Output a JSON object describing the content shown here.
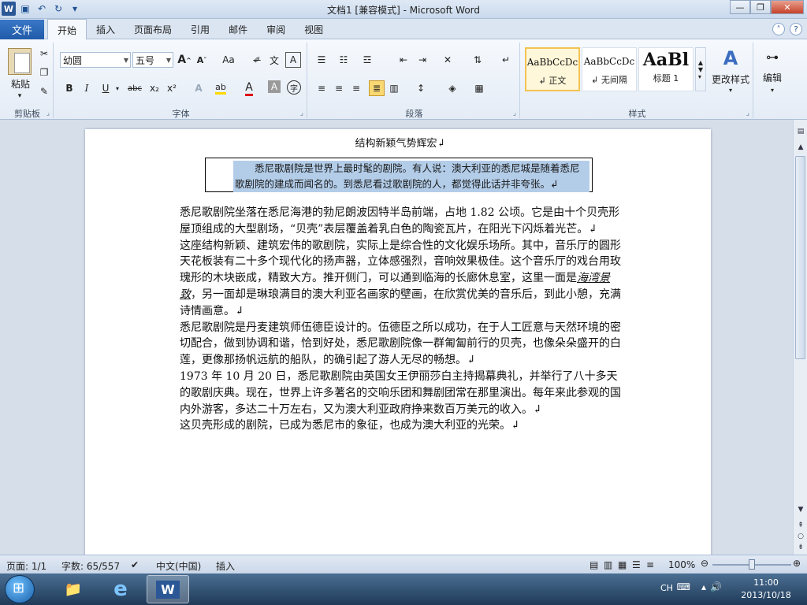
{
  "window": {
    "title": "文档1 [兼容模式] - Microsoft Word",
    "app_icon": "W"
  },
  "tabs": {
    "file": "文件",
    "items": [
      "开始",
      "插入",
      "页面布局",
      "引用",
      "邮件",
      "审阅",
      "视图"
    ],
    "active": "开始"
  },
  "ribbon": {
    "clipboard": {
      "label": "剪贴板",
      "paste": "粘贴"
    },
    "font": {
      "label": "字体",
      "font_name": "幼圆",
      "font_size": "五号",
      "grow": "A",
      "shrink": "A",
      "change_case": "Aa",
      "bold": "B",
      "italic": "I",
      "underline": "U",
      "strike": "abc",
      "subscript": "x₂",
      "superscript": "x²",
      "text_effect": "A",
      "highlight": "ab",
      "font_color": "A",
      "char_shading": "A",
      "enclose": "字"
    },
    "paragraph": {
      "label": "段落"
    },
    "styles": {
      "label": "样式",
      "items": [
        {
          "sample": "AaBbCcDc",
          "name": "↲ 正文"
        },
        {
          "sample": "AaBbCcDc",
          "name": "↲ 无间隔"
        },
        {
          "sample": "AaBl",
          "name": "标题 1"
        }
      ],
      "change_styles": "更改样式"
    },
    "editing": {
      "label": "编辑"
    }
  },
  "document": {
    "title": "结构新颖气势辉宏↲",
    "quote": "悉尼歌剧院是世界上最时髦的剧院。有人说：澳大利亚的悉尼城是随着悉尼歌剧院的建成而闻名的。到悉尼看过歌剧院的人，都觉得此话并非夸张。↲",
    "paragraphs": [
      "悉尼歌剧院坐落在悉尼海港的勃尼朗波因特半岛前端，占地 1.82 公顷。它是由十个贝壳形屋顶组成的大型剧场，“贝壳”表层覆盖着乳白色的陶瓷瓦片，在阳光下闪烁着光芒。↲",
      "这座结构新颖、建筑宏伟的歌剧院，实际上是综合性的文化娱乐场所。其中，音乐厅的圆形天花板装有二十多个现代化的扬声器，立体感强烈，音响效果极佳。这个音乐厅的戏台用玫瑰形的木块嵌成，精致大方。推开侧门，可以通到临海的长廊休息室，这里一面是",
      "，另一面却是琳琅满目的澳大利亚名画家的壁画，在欣赏优美的音乐后，到此小憩，充满诗情画意。↲",
      "悉尼歌剧院是丹麦建筑师伍德臣设计的。伍德臣之所以成功，在于人工匠意与天然环境的密切配合，做到协调和谐，恰到好处，悉尼歌剧院像一群匍匐前行的贝壳，也像朵朵盛开的白莲，更像那扬帆远航的船队，的确引起了游人无尽的畅想。↲",
      "1973 年 10 月 20 日，悉尼歌剧院由英国女王伊丽莎白主持揭幕典礼，并举行了八十多天的歌剧庆典。现在，世界上许多著名的交响乐团和舞剧团常在那里演出。每年来此参观的国内外游客，多达二十万左右，又为澳大利亚政府挣来数百万美元的收入。↲",
      "这贝壳形成的剧院，已成为悉尼市的象征，也成为澳大利亚的光荣。↲"
    ],
    "italic_phrase": "海湾景致"
  },
  "statusbar": {
    "page": "页面: 1/1",
    "words": "字数: 65/557",
    "language": "中文(中国)",
    "mode": "插入",
    "zoom": "100%",
    "zoom_fraction": 0.5
  },
  "taskbar": {
    "ime": "CH",
    "time": "11:00",
    "date": "2013/10/18"
  },
  "colors": {
    "accent": "#2b5797",
    "selection": "#b3cde9",
    "style_selected": "#f3c355"
  }
}
